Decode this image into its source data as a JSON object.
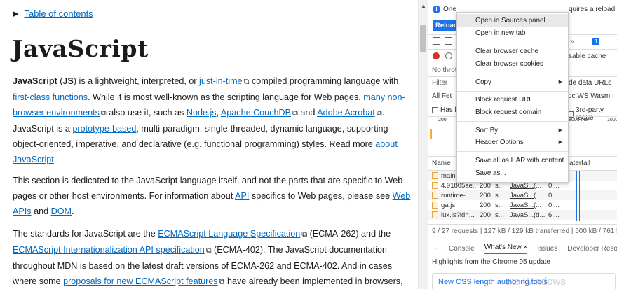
{
  "article": {
    "toc_label": "Table of contents",
    "title": "JavaScript",
    "p1": {
      "t0": "JavaScript",
      "t1": " (",
      "t2": "JS",
      "t3": ") is a lightweight, interpreted, or ",
      "l1": "just-in-time",
      "t4": " compiled programming language with ",
      "l2": "first-class functions",
      "t5": ". While it is most well-known as the scripting language for Web pages, ",
      "l3": "many non-browser environments",
      "t6": " also use it, such as ",
      "l4": "Node.js",
      "t7": ", ",
      "l5": "Apache CouchDB",
      "t8": " and ",
      "l6": "Adobe Acrobat",
      "t9": ". JavaScript is a ",
      "l7": "prototype-based",
      "t10": ", multi-paradigm, single-threaded, dynamic language, supporting object-oriented, imperative, and declarative (e.g. functional programming) styles. Read more ",
      "l8": "about JavaScript",
      "t11": "."
    },
    "p2": {
      "t0": "This section is dedicated to the JavaScript language itself, and not the parts that are specific to Web pages or other host environments. For information about ",
      "l1": "API",
      "t1": " specifics to Web pages, please see ",
      "l2": "Web APIs",
      "t2": " and ",
      "l3": "DOM",
      "t3": "."
    },
    "p3": {
      "t0": "The standards for JavaScript are the ",
      "l1": "ECMAScript Language Specification",
      "t1": " (ECMA-262) and the ",
      "l2": "ECMAScript Internationalization API specification",
      "t2": " (ECMA-402). The JavaScript documentation throughout MDN is based on the latest draft versions of ECMA-262 and ECMA-402. And in cases where some ",
      "l3": "proposals for new ECMAScript features",
      "t3": " have already been implemented in browsers,"
    },
    "external_icon": "⧉"
  },
  "devtools": {
    "info_left": "One",
    "info_right": "quires a reload to t",
    "reload_label": "Reload",
    "more_tabs": "»",
    "console_badge": "1",
    "disable_cache": "sable cache",
    "throttle": "No throt",
    "filter": "Filter",
    "hide_data_urls": "de data URLs",
    "types_left": "All  Fet",
    "types_right": "oc  WS  Wasm  I",
    "has_blocked": "Has b",
    "third_party": "3rd-party reque",
    "ticks": [
      "200",
      "8000 ms",
      "1000"
    ],
    "name_header": "Name",
    "waterfall_header": "aterfall",
    "rows": [
      {
        "name": "main",
        "status": "",
        "type": "",
        "init": "",
        "size": ""
      },
      {
        "name": "4.91805ae...",
        "status": "200",
        "type": "s...",
        "init": "JavaS...",
        "size": "(...",
        "time": "0 ..."
      },
      {
        "name": "runtime-...",
        "status": "200",
        "type": "s...",
        "init": "JavaS...",
        "size": "(...",
        "time": "0 ..."
      },
      {
        "name": "ga.js",
        "status": "200",
        "type": "s...",
        "init": "JavaS...",
        "size": "(...",
        "time": "0 ..."
      },
      {
        "name": "lux.js?id=...",
        "status": "200",
        "type": "s...",
        "init": "JavaS...",
        "size": "(d...",
        "time": "6 ..."
      }
    ],
    "footer": "9 / 27 requests  |  127 kB / 129 kB transferred  |  500 kB / 761 kB r",
    "drawer_tabs": [
      "Console",
      "What's New",
      "Issues",
      "Developer Resources"
    ],
    "drawer_close": "×",
    "highlights": "Highlights from the Chrome 95 update",
    "card_text": "New CSS length authoring tools",
    "watermark": "ate Windows"
  },
  "context_menu": {
    "items": [
      {
        "label": "Open in Sources panel",
        "highlighted": true
      },
      {
        "label": "Open in new tab"
      },
      {
        "label": "Clear browser cache"
      },
      {
        "label": "Clear browser cookies"
      },
      {
        "label": "Copy",
        "submenu": true
      },
      {
        "label": "Block request URL"
      },
      {
        "label": "Block request domain"
      },
      {
        "label": "Sort By",
        "submenu": true
      },
      {
        "label": "Header Options",
        "submenu": true
      },
      {
        "label": "Save all as HAR with content"
      },
      {
        "label": "Save as..."
      }
    ]
  }
}
